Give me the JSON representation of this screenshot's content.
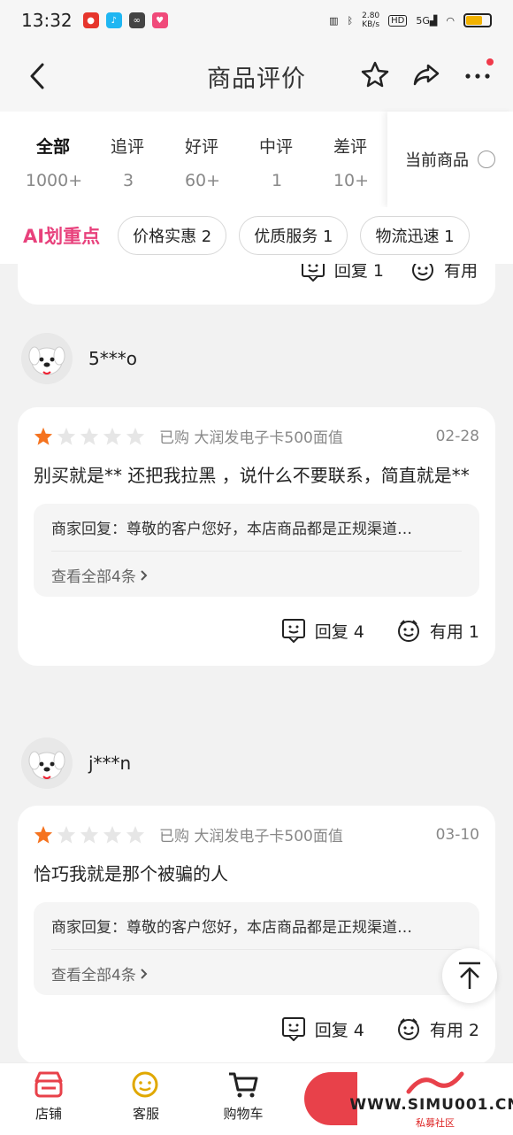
{
  "status_bar": {
    "time": "13:32",
    "net_speed": "2.80\nKB/s",
    "net_speed_line1": "2.80",
    "net_speed_line2": "KB/s",
    "hd": "HD",
    "signal": "5G"
  },
  "header": {
    "title": "商品评价"
  },
  "tabs": [
    {
      "label": "全部",
      "count": "1000+"
    },
    {
      "label": "追评",
      "count": "3"
    },
    {
      "label": "好评",
      "count": "60+"
    },
    {
      "label": "中评",
      "count": "1"
    },
    {
      "label": "差评",
      "count": "10+"
    }
  ],
  "current_goods_label": "当前商品",
  "ai": {
    "label": "AI划重点",
    "chips": [
      "价格实惠 2",
      "优质服务 1",
      "物流迅速 1"
    ]
  },
  "partial_card": {
    "reply_label": "回复 1",
    "useful_label": "有用"
  },
  "reviews": [
    {
      "user": "5***o",
      "rating": 1,
      "purchased": "已购 大润发电子卡500面值",
      "date": "02-28",
      "text": "别买就是** 还把我拉黑 ，说什么不要联系，简直就是**",
      "merchant_reply": "商家回复：尊敬的客户您好，本店商品都是正规渠道…",
      "see_all": "查看全部4条",
      "reply_label": "回复 4",
      "useful_label": "有用 1"
    },
    {
      "user": "j***n",
      "rating": 1,
      "purchased": "已购 大润发电子卡500面值",
      "date": "03-10",
      "text": "恰巧我就是那个被骗的人",
      "merchant_reply": "商家回复：尊敬的客户您好，本店商品都是正规渠道…",
      "see_all": "查看全部4条",
      "reply_label": "回复 4",
      "useful_label": "有用 2"
    }
  ],
  "bottom_bar": {
    "store": "店铺",
    "service": "客服",
    "cart": "购物车"
  },
  "watermark": {
    "text": "WWW.SIMU001.CN",
    "sub": "私募社区"
  },
  "colors": {
    "accent_pink": "#e8417c",
    "star_orange": "#f5731f",
    "brand_red": "#e8414a"
  }
}
